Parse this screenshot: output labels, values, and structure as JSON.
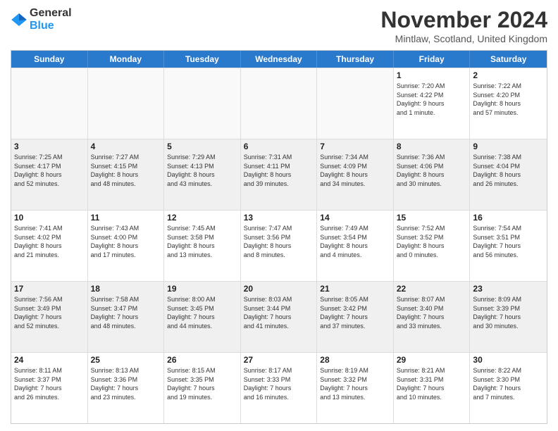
{
  "logo": {
    "line1": "General",
    "line2": "Blue"
  },
  "title": "November 2024",
  "location": "Mintlaw, Scotland, United Kingdom",
  "weekdays": [
    "Sunday",
    "Monday",
    "Tuesday",
    "Wednesday",
    "Thursday",
    "Friday",
    "Saturday"
  ],
  "weeks": [
    [
      {
        "day": "",
        "info": ""
      },
      {
        "day": "",
        "info": ""
      },
      {
        "day": "",
        "info": ""
      },
      {
        "day": "",
        "info": ""
      },
      {
        "day": "",
        "info": ""
      },
      {
        "day": "1",
        "info": "Sunrise: 7:20 AM\nSunset: 4:22 PM\nDaylight: 9 hours\nand 1 minute."
      },
      {
        "day": "2",
        "info": "Sunrise: 7:22 AM\nSunset: 4:20 PM\nDaylight: 8 hours\nand 57 minutes."
      }
    ],
    [
      {
        "day": "3",
        "info": "Sunrise: 7:25 AM\nSunset: 4:17 PM\nDaylight: 8 hours\nand 52 minutes."
      },
      {
        "day": "4",
        "info": "Sunrise: 7:27 AM\nSunset: 4:15 PM\nDaylight: 8 hours\nand 48 minutes."
      },
      {
        "day": "5",
        "info": "Sunrise: 7:29 AM\nSunset: 4:13 PM\nDaylight: 8 hours\nand 43 minutes."
      },
      {
        "day": "6",
        "info": "Sunrise: 7:31 AM\nSunset: 4:11 PM\nDaylight: 8 hours\nand 39 minutes."
      },
      {
        "day": "7",
        "info": "Sunrise: 7:34 AM\nSunset: 4:09 PM\nDaylight: 8 hours\nand 34 minutes."
      },
      {
        "day": "8",
        "info": "Sunrise: 7:36 AM\nSunset: 4:06 PM\nDaylight: 8 hours\nand 30 minutes."
      },
      {
        "day": "9",
        "info": "Sunrise: 7:38 AM\nSunset: 4:04 PM\nDaylight: 8 hours\nand 26 minutes."
      }
    ],
    [
      {
        "day": "10",
        "info": "Sunrise: 7:41 AM\nSunset: 4:02 PM\nDaylight: 8 hours\nand 21 minutes."
      },
      {
        "day": "11",
        "info": "Sunrise: 7:43 AM\nSunset: 4:00 PM\nDaylight: 8 hours\nand 17 minutes."
      },
      {
        "day": "12",
        "info": "Sunrise: 7:45 AM\nSunset: 3:58 PM\nDaylight: 8 hours\nand 13 minutes."
      },
      {
        "day": "13",
        "info": "Sunrise: 7:47 AM\nSunset: 3:56 PM\nDaylight: 8 hours\nand 8 minutes."
      },
      {
        "day": "14",
        "info": "Sunrise: 7:49 AM\nSunset: 3:54 PM\nDaylight: 8 hours\nand 4 minutes."
      },
      {
        "day": "15",
        "info": "Sunrise: 7:52 AM\nSunset: 3:52 PM\nDaylight: 8 hours\nand 0 minutes."
      },
      {
        "day": "16",
        "info": "Sunrise: 7:54 AM\nSunset: 3:51 PM\nDaylight: 7 hours\nand 56 minutes."
      }
    ],
    [
      {
        "day": "17",
        "info": "Sunrise: 7:56 AM\nSunset: 3:49 PM\nDaylight: 7 hours\nand 52 minutes."
      },
      {
        "day": "18",
        "info": "Sunrise: 7:58 AM\nSunset: 3:47 PM\nDaylight: 7 hours\nand 48 minutes."
      },
      {
        "day": "19",
        "info": "Sunrise: 8:00 AM\nSunset: 3:45 PM\nDaylight: 7 hours\nand 44 minutes."
      },
      {
        "day": "20",
        "info": "Sunrise: 8:03 AM\nSunset: 3:44 PM\nDaylight: 7 hours\nand 41 minutes."
      },
      {
        "day": "21",
        "info": "Sunrise: 8:05 AM\nSunset: 3:42 PM\nDaylight: 7 hours\nand 37 minutes."
      },
      {
        "day": "22",
        "info": "Sunrise: 8:07 AM\nSunset: 3:40 PM\nDaylight: 7 hours\nand 33 minutes."
      },
      {
        "day": "23",
        "info": "Sunrise: 8:09 AM\nSunset: 3:39 PM\nDaylight: 7 hours\nand 30 minutes."
      }
    ],
    [
      {
        "day": "24",
        "info": "Sunrise: 8:11 AM\nSunset: 3:37 PM\nDaylight: 7 hours\nand 26 minutes."
      },
      {
        "day": "25",
        "info": "Sunrise: 8:13 AM\nSunset: 3:36 PM\nDaylight: 7 hours\nand 23 minutes."
      },
      {
        "day": "26",
        "info": "Sunrise: 8:15 AM\nSunset: 3:35 PM\nDaylight: 7 hours\nand 19 minutes."
      },
      {
        "day": "27",
        "info": "Sunrise: 8:17 AM\nSunset: 3:33 PM\nDaylight: 7 hours\nand 16 minutes."
      },
      {
        "day": "28",
        "info": "Sunrise: 8:19 AM\nSunset: 3:32 PM\nDaylight: 7 hours\nand 13 minutes."
      },
      {
        "day": "29",
        "info": "Sunrise: 8:21 AM\nSunset: 3:31 PM\nDaylight: 7 hours\nand 10 minutes."
      },
      {
        "day": "30",
        "info": "Sunrise: 8:22 AM\nSunset: 3:30 PM\nDaylight: 7 hours\nand 7 minutes."
      }
    ]
  ]
}
